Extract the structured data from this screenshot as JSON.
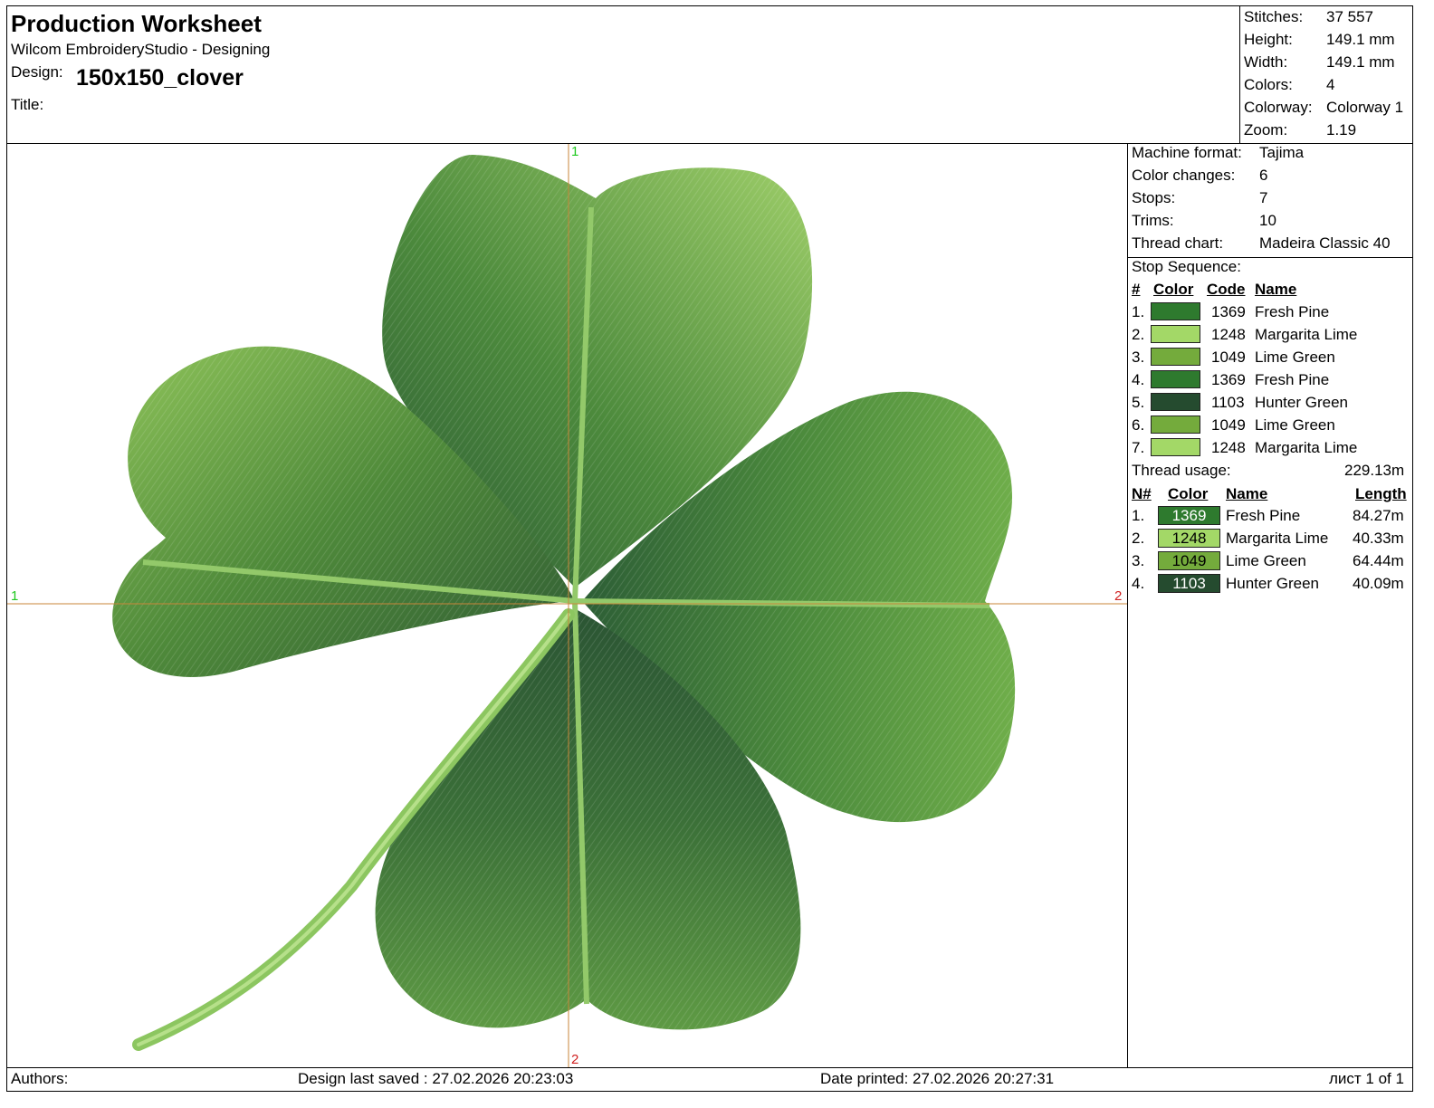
{
  "header": {
    "title": "Production Worksheet",
    "app": "Wilcom EmbroideryStudio - Designing",
    "design_label": "Design:",
    "design_name": "150x150_clover",
    "title_label": "Title:"
  },
  "summary": [
    {
      "label": "Stitches:",
      "value": "37 557"
    },
    {
      "label": "Height:",
      "value": "149.1 mm"
    },
    {
      "label": "Width:",
      "value": "149.1 mm"
    },
    {
      "label": "Colors:",
      "value": "4"
    },
    {
      "label": "Colorway:",
      "value": "Colorway 1"
    },
    {
      "label": "Zoom:",
      "value": "1.19"
    }
  ],
  "machine": [
    {
      "label": "Machine format:",
      "value": "Tajima"
    },
    {
      "label": "Color changes:",
      "value": "6"
    },
    {
      "label": "Stops:",
      "value": "7"
    },
    {
      "label": "Trims:",
      "value": "10"
    },
    {
      "label": "Thread chart:",
      "value": "Madeira Classic 40"
    }
  ],
  "stop_sequence": {
    "title": "Stop Sequence:",
    "headers": {
      "num": "#",
      "color": "Color",
      "code": "Code",
      "name": "Name"
    },
    "rows": [
      {
        "num": "1.",
        "color": "#2e7a2e",
        "code": "1369",
        "name": "Fresh Pine"
      },
      {
        "num": "2.",
        "color": "#a3d867",
        "code": "1248",
        "name": "Margarita Lime"
      },
      {
        "num": "3.",
        "color": "#74ab3c",
        "code": "1049",
        "name": "Lime Green"
      },
      {
        "num": "4.",
        "color": "#2e7a2e",
        "code": "1369",
        "name": "Fresh Pine"
      },
      {
        "num": "5.",
        "color": "#254b2f",
        "code": "1103",
        "name": "Hunter Green"
      },
      {
        "num": "6.",
        "color": "#74ab3c",
        "code": "1049",
        "name": "Lime Green"
      },
      {
        "num": "7.",
        "color": "#a3d867",
        "code": "1248",
        "name": "Margarita Lime"
      }
    ]
  },
  "thread_usage": {
    "label": "Thread usage:",
    "total": "229.13m",
    "headers": {
      "num": "N#",
      "color": "Color",
      "name": "Name",
      "length": "Length"
    },
    "rows": [
      {
        "num": "1.",
        "color": "#2e7a2e",
        "code": "1369",
        "name": "Fresh Pine",
        "length": "84.27m"
      },
      {
        "num": "2.",
        "color": "#a3d867",
        "code": "1248",
        "name": "Margarita Lime",
        "length": "40.33m"
      },
      {
        "num": "3.",
        "color": "#74ab3c",
        "code": "1049",
        "name": "Lime Green",
        "length": "64.44m"
      },
      {
        "num": "4.",
        "color": "#254b2f",
        "code": "1103",
        "name": "Hunter Green",
        "length": "40.09m"
      }
    ]
  },
  "crosshair": {
    "top": "1",
    "bottom": "2",
    "left": "1",
    "right": "2"
  },
  "footer": {
    "authors": "Authors:",
    "saved": "Design last saved : 27.02.2026 20:23:03",
    "printed": "Date printed: 27.02.2026 20:27:31",
    "page": "лист 1 of 1"
  }
}
